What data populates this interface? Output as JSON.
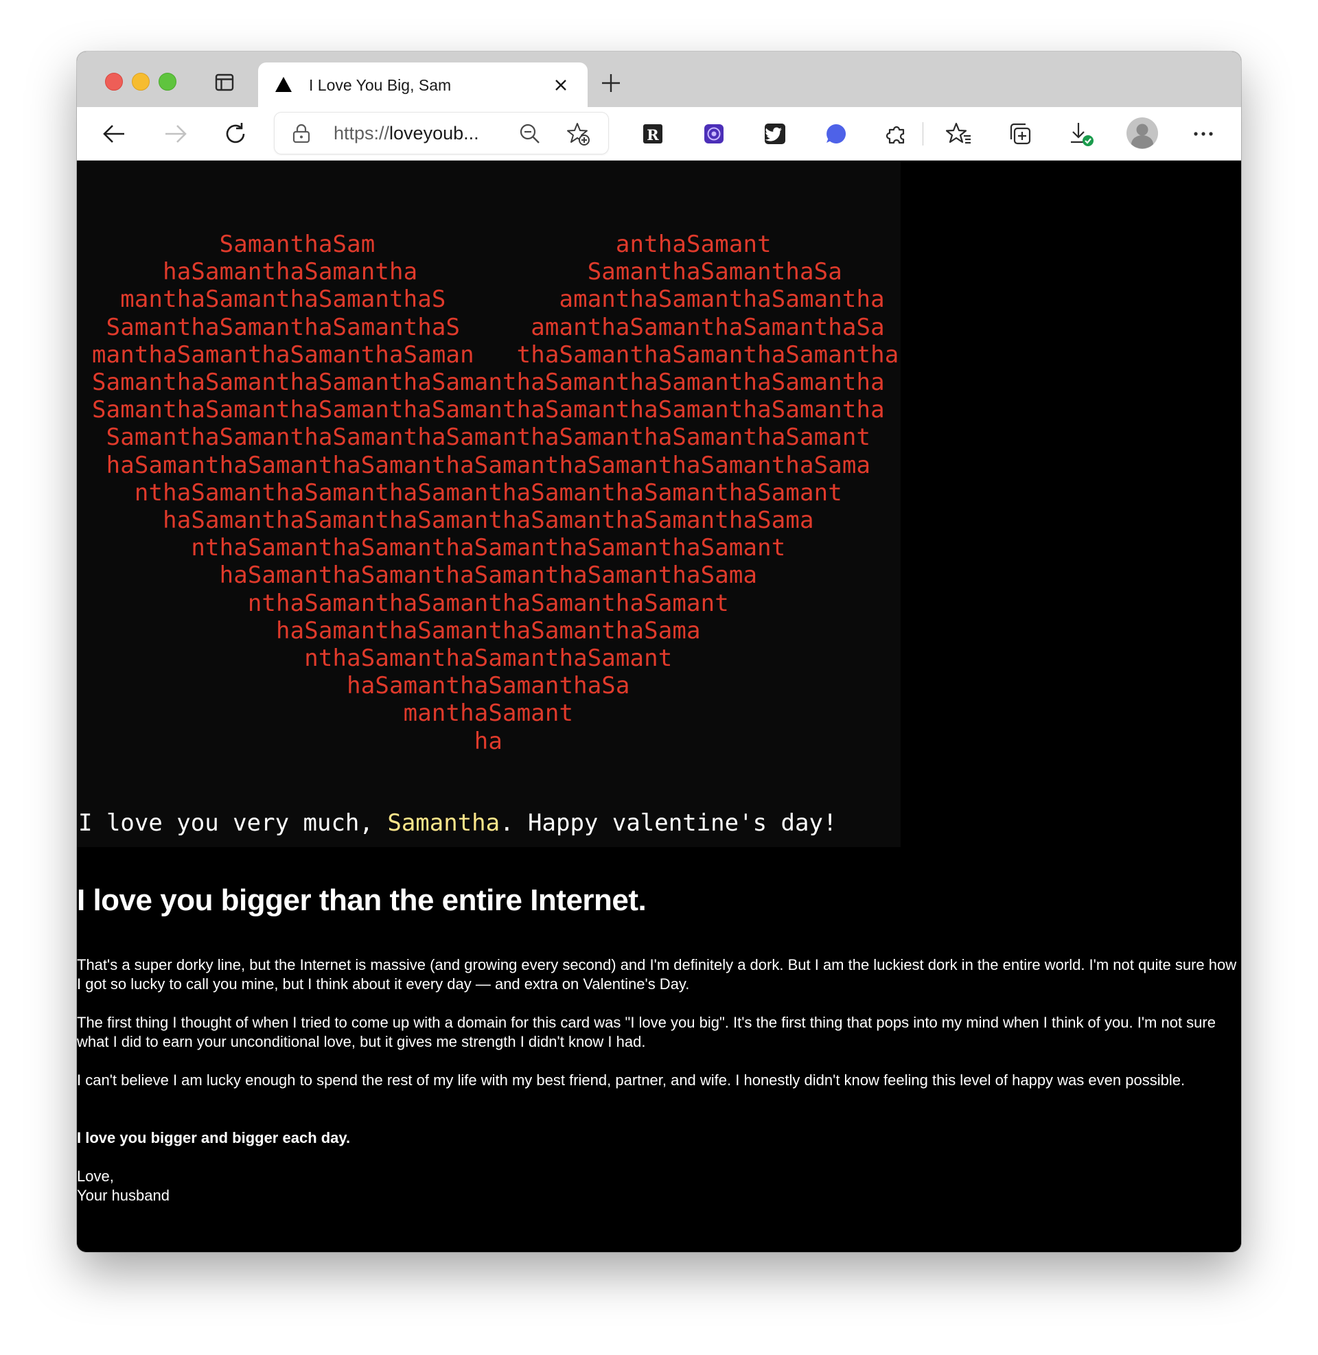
{
  "browser": {
    "tab": {
      "title": "I Love You Big, Sam"
    },
    "address": {
      "scheme": "https://",
      "host": "loveyoub..."
    },
    "toolbar_icons": [
      "back-icon",
      "forward-icon",
      "refresh-icon",
      "readwise-extension-icon",
      "purple-extension-icon",
      "twitter-extension-icon",
      "blue-chat-extension-icon",
      "extensions-icon",
      "favorites-icon",
      "collections-icon",
      "downloads-icon",
      "profile-avatar",
      "more-menu-icon"
    ]
  },
  "page": {
    "heart_lines": [
      "         SamanthaSam                 anthaSamant",
      "     haSamanthaSamantha            SamanthaSamanthaSa",
      "  manthaSamanthaSamanthaS        amanthaSamanthaSamantha",
      " SamanthaSamanthaSamanthaS     amanthaSamanthaSamanthaSa",
      "manthaSamanthaSamanthaSaman   thaSamanthaSamanthaSamantha",
      "SamanthaSamanthaSamanthaSamanthaSamanthaSamanthaSamantha",
      "SamanthaSamanthaSamanthaSamanthaSamanthaSamanthaSamantha",
      " SamanthaSamanthaSamanthaSamanthaSamanthaSamanthaSamant",
      " haSamanthaSamanthaSamanthaSamanthaSamanthaSamanthaSama",
      "   nthaSamanthaSamanthaSamanthaSamanthaSamanthaSamant",
      "     haSamanthaSamanthaSamanthaSamanthaSamanthaSama",
      "       nthaSamanthaSamanthaSamanthaSamanthaSamant",
      "         haSamanthaSamanthaSamanthaSamanthaSama",
      "           nthaSamanthaSamanthaSamanthaSamant",
      "             haSamanthaSamanthaSamanthaSama",
      "               nthaSamanthaSamanthaSamant",
      "                  haSamanthaSamanthaSa",
      "                      manthaSamant",
      "                           ha"
    ],
    "love_line": {
      "before": "I love you very much, ",
      "name": "Samantha",
      "after": ". Happy valentine's day!"
    },
    "heading": "I love you bigger than the entire Internet.",
    "paragraphs": [
      "That's a super dorky line, but the Internet is massive (and growing every second) and I'm definitely a dork. But I am the luckiest dork in the entire world. I'm not quite sure how I got so lucky to call you mine, but I think about it every day — and extra on Valentine's Day.",
      "The first thing I thought of when I tried to come up with a domain for this card was \"I love you big\". It's the first thing that pops into my mind when I think of you. I'm not sure what I did to earn your unconditional love, but it gives me strength I didn't know I had.",
      "I can't believe I am lucky enough to spend the rest of my life with my best friend, partner, and wife. I honestly didn't know feeling this level of happy was even possible."
    ],
    "closing_bold": "I love you bigger and bigger each day.",
    "signoff": "Love,",
    "signature": "Your husband"
  },
  "colors": {
    "heart": "#e03a2b",
    "name_highlight": "#fbe58a",
    "background": "#000000"
  }
}
